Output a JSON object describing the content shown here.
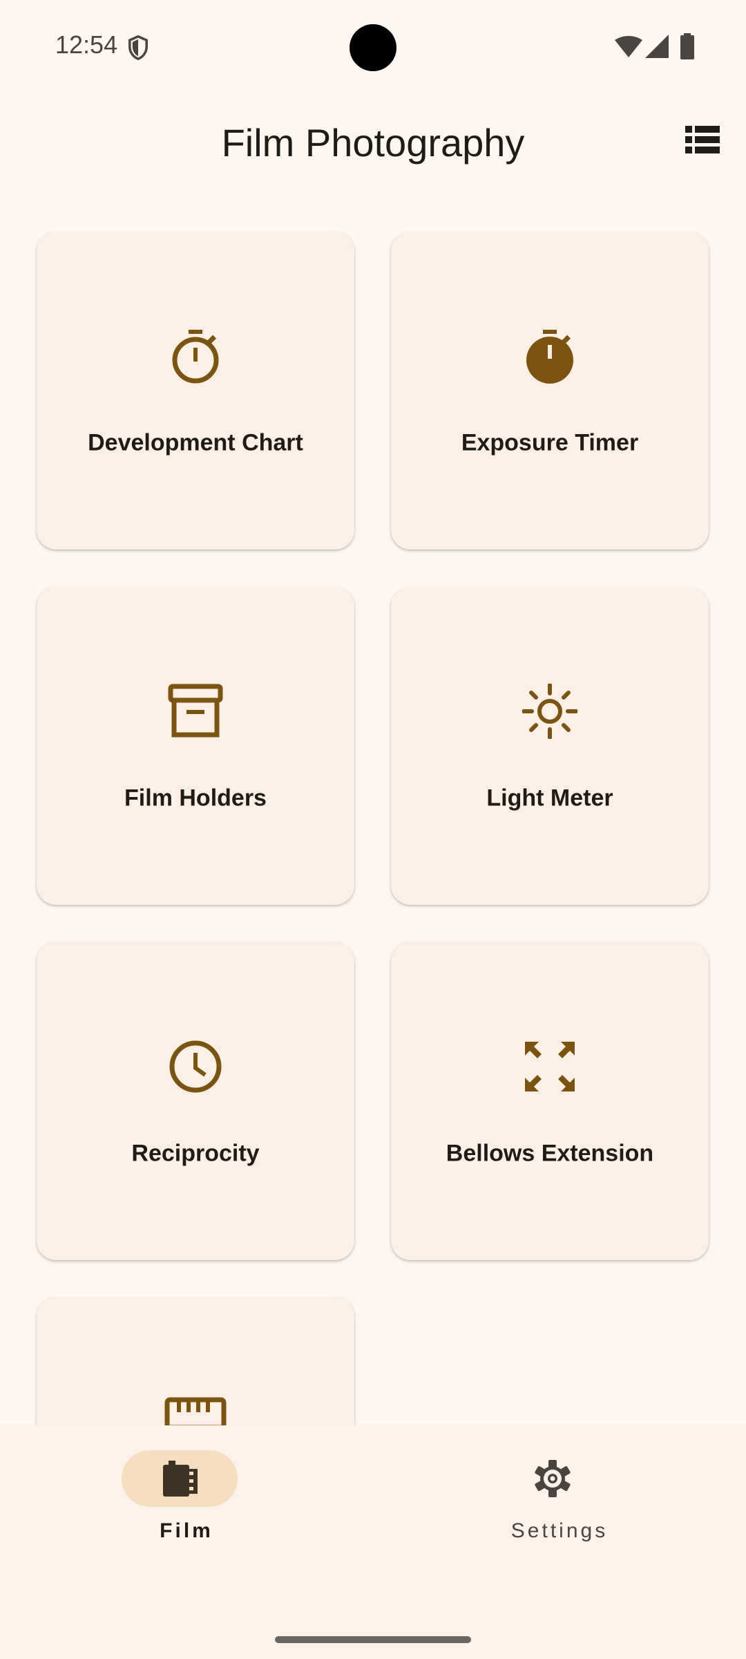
{
  "status_bar": {
    "time": "12:54"
  },
  "header": {
    "title": "Film Photography"
  },
  "tiles": [
    {
      "label": "Development Chart",
      "icon": "stopwatch-outline-icon"
    },
    {
      "label": "Exposure Timer",
      "icon": "stopwatch-filled-icon"
    },
    {
      "label": "Film Holders",
      "icon": "archive-box-icon"
    },
    {
      "label": "Light Meter",
      "icon": "sun-icon"
    },
    {
      "label": "Reciprocity",
      "icon": "clock-icon"
    },
    {
      "label": "Bellows Extension",
      "icon": "expand-arrows-icon"
    },
    {
      "label": "",
      "icon": "ruler-icon"
    }
  ],
  "bottom_nav": {
    "items": [
      {
        "label": "Film",
        "icon": "film-canister-icon",
        "selected": true
      },
      {
        "label": "Settings",
        "icon": "gear-icon",
        "selected": false
      }
    ]
  },
  "colors": {
    "background": "#FDF6F1",
    "tile_background": "#FCF0E6",
    "icon_brown": "#7A5410",
    "nav_indicator": "#F5DFBE",
    "text": "#1F1B16"
  }
}
